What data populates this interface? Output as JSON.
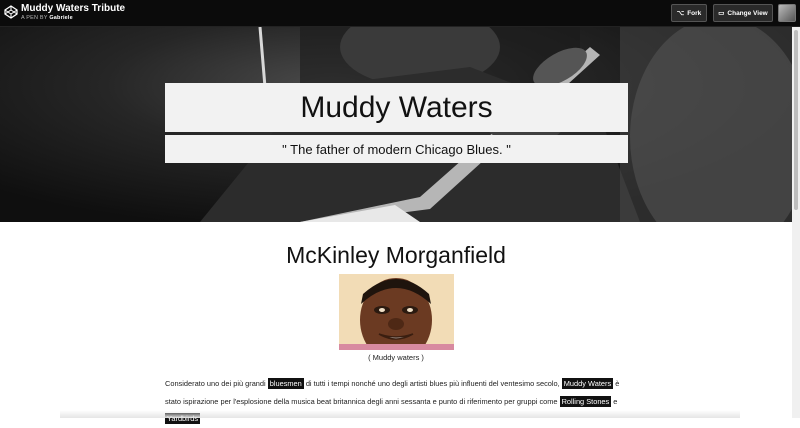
{
  "topbar": {
    "pen_title": "Muddy Waters Tribute",
    "pen_by_prefix": "A PEN BY",
    "author": "Gabriele",
    "fork_label": "Fork",
    "change_view_label": "Change View"
  },
  "hero": {
    "title": "Muddy Waters",
    "subtitle": "\" The father of modern Chicago Blues. \""
  },
  "content": {
    "heading": "McKinley Morganfield",
    "caption": "( Muddy waters )",
    "paragraph": [
      {
        "text": "Considerato uno dei più grandi ",
        "hl": false
      },
      {
        "text": "bluesmen",
        "hl": true
      },
      {
        "text": " di tutti i tempi nonché uno degli artisti blues più influenti del ventesimo secolo, ",
        "hl": false
      },
      {
        "text": "Muddy Waters",
        "hl": true
      },
      {
        "text": " è stato ispirazione per l'esplosione della musica beat britannica degli anni sessanta e punto di riferimento per gruppi come ",
        "hl": false
      },
      {
        "text": "Rolling Stones",
        "hl": true
      },
      {
        "text": " e ",
        "hl": false
      },
      {
        "text": "Yardbirds",
        "hl": true
      }
    ]
  }
}
